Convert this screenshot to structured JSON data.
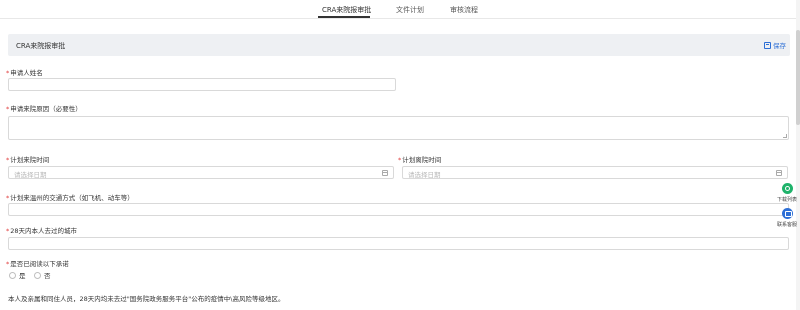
{
  "tabs": [
    {
      "label": "CRA来院报审批"
    },
    {
      "label": "文件计划"
    },
    {
      "label": "审核流程"
    }
  ],
  "section": {
    "title": "CRA来院报审批",
    "save_label": "保存"
  },
  "form": {
    "required_mark": "*",
    "applicant_name": {
      "label": "申请人姓名",
      "value": ""
    },
    "visit_reason": {
      "label": "申请来院原因（必要性）",
      "value": ""
    },
    "planned_arrival": {
      "label": "计划来院时间",
      "placeholder": "请选择日期"
    },
    "planned_departure": {
      "label": "计划离院时间",
      "placeholder": "请选择日期"
    },
    "transport": {
      "label": "计划来温州的交通方式（如飞机、动车等）",
      "value": ""
    },
    "cities_28d": {
      "label": "28天内本人去过的城市",
      "value": ""
    },
    "commitment": {
      "label": "是否已阅读以下承诺",
      "options": [
        "是",
        "否"
      ]
    }
  },
  "notice": "本人及亲属和同住人员，28天内均未去过\"国务院政务服务平台\"公布的疫情中\\高风险等级地区。",
  "float_buttons": [
    {
      "label": "下载列表",
      "icon": "download-icon"
    },
    {
      "label": "联系客服",
      "icon": "customer-service-icon"
    }
  ],
  "colors": {
    "accent": "#2d6fd6",
    "required": "#e03a3a",
    "section_bg": "#eef0f3",
    "float_green": "#1fb36b"
  }
}
